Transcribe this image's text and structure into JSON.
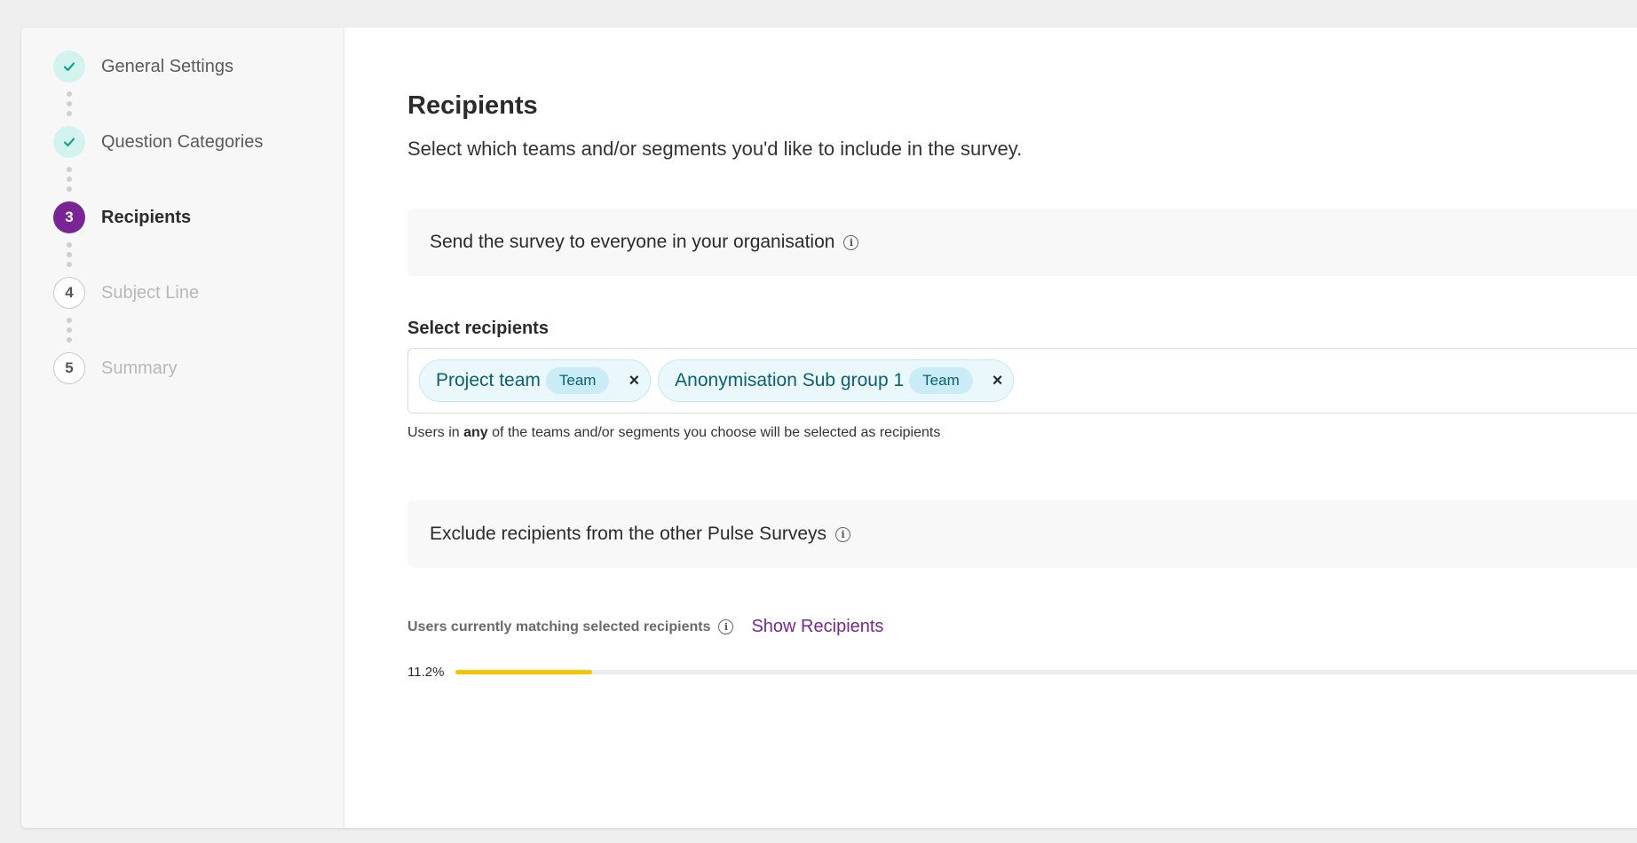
{
  "sidebar": {
    "steps": [
      {
        "number": "1",
        "label": "General Settings",
        "state": "done"
      },
      {
        "number": "2",
        "label": "Question Categories",
        "state": "done"
      },
      {
        "number": "3",
        "label": "Recipients",
        "state": "active"
      },
      {
        "number": "4",
        "label": "Subject Line",
        "state": "todo"
      },
      {
        "number": "5",
        "label": "Summary",
        "state": "todo"
      }
    ]
  },
  "main": {
    "title": "Recipients",
    "subtitle": "Select which teams and/or segments you'd like to include in the survey.",
    "send_all_label": "Send the survey to everyone in your organisation",
    "select_label": "Select recipients",
    "chips": [
      {
        "name": "Project team",
        "tag": "Team",
        "remove": "×"
      },
      {
        "name": "Anonymisation Sub group 1",
        "tag": "Team",
        "remove": "×"
      }
    ],
    "helper_pre": "Users in ",
    "helper_bold": "any",
    "helper_post": " of the teams and/or segments you choose will be selected as recipients",
    "exclude_label": "Exclude recipients from the other Pulse Surveys",
    "match_label": "Users currently matching selected recipients",
    "show_recipients": "Show Recipients",
    "progress_text": "11.2%",
    "progress_fraction": 0.112
  },
  "colors": {
    "accent": "#7a2596",
    "done": "#1aa38a",
    "progress": "#f5c400",
    "chip_text": "#0b5f75"
  },
  "icons": {
    "check": "check-icon",
    "info": "info-icon",
    "remove": "close-icon"
  }
}
